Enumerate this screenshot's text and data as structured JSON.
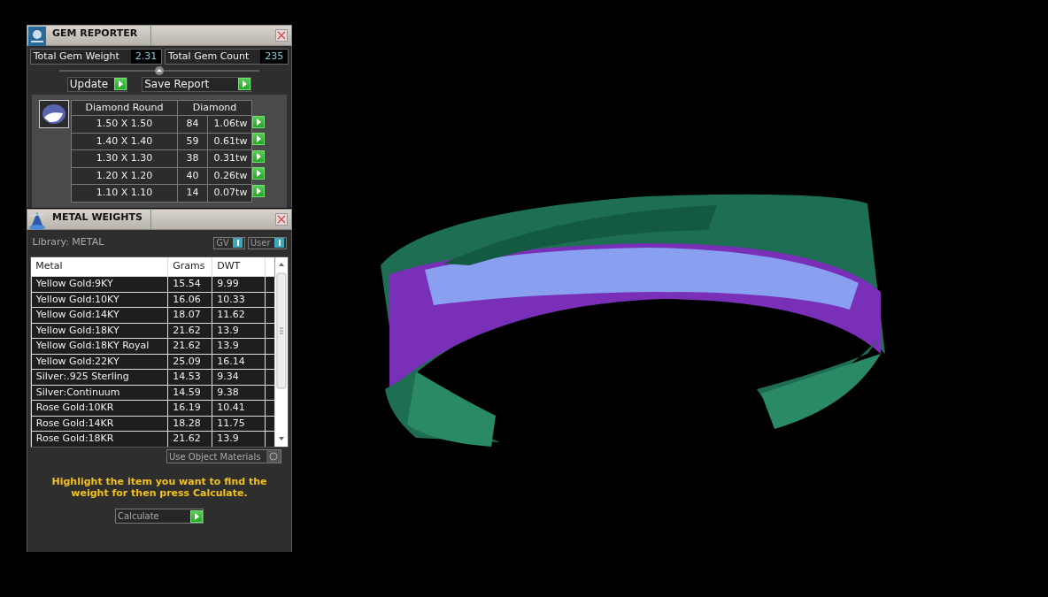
{
  "gem_reporter": {
    "title": "GEM REPORTER",
    "total_weight_label": "Total Gem Weight",
    "total_weight": "2.31",
    "total_count_label": "Total Gem Count",
    "total_count": "235",
    "buttons": [
      "Update",
      "Save Report"
    ],
    "table": {
      "columns": [
        "Diamond Round",
        "Diamond"
      ],
      "rows": [
        {
          "size": "1.50 X 1.50",
          "count": "84",
          "weight": "1.06tw"
        },
        {
          "size": "1.40 X 1.40",
          "count": "59",
          "weight": "0.61tw"
        },
        {
          "size": "1.30 X 1.30",
          "count": "38",
          "weight": "0.31tw"
        },
        {
          "size": "1.20 X 1.20",
          "count": "40",
          "weight": "0.26tw"
        },
        {
          "size": "1.10 X 1.10",
          "count": "14",
          "weight": "0.07tw"
        }
      ]
    }
  },
  "metal_weights": {
    "title": "METAL WEIGHTS",
    "library": "Library: METAL",
    "toggles": [
      {
        "label": "GV",
        "on": true
      },
      {
        "label": "User",
        "on": true
      }
    ],
    "table": {
      "columns": [
        "Metal",
        "Grams",
        "DWT"
      ],
      "rows": [
        {
          "metal": "Yellow Gold:9KY",
          "grams": "15.54",
          "dwt": "9.99"
        },
        {
          "metal": "Yellow Gold:10KY",
          "grams": "16.06",
          "dwt": "10.33"
        },
        {
          "metal": "Yellow Gold:14KY",
          "grams": "18.07",
          "dwt": "11.62"
        },
        {
          "metal": "Yellow Gold:18KY",
          "grams": "21.62",
          "dwt": "13.9"
        },
        {
          "metal": "Yellow Gold:18KY Royal",
          "grams": "21.62",
          "dwt": "13.9"
        },
        {
          "metal": "Yellow Gold:22KY",
          "grams": "25.09",
          "dwt": "16.14"
        },
        {
          "metal": "Silver:.925 Sterling",
          "grams": "14.53",
          "dwt": "9.34"
        },
        {
          "metal": "Silver:Continuum",
          "grams": "14.59",
          "dwt": "9.38"
        },
        {
          "metal": "Rose Gold:10KR",
          "grams": "16.19",
          "dwt": "10.41"
        },
        {
          "metal": "Rose Gold:14KR",
          "grams": "18.28",
          "dwt": "11.75"
        },
        {
          "metal": "Rose Gold:18KR",
          "grams": "21.62",
          "dwt": "13.9"
        }
      ]
    },
    "use_object_materials": {
      "label": "Use Object Materials",
      "checked": false
    },
    "message": "Highlight the item you want to find the weight for then press Calculate.",
    "calculate_button": "Calculate"
  }
}
